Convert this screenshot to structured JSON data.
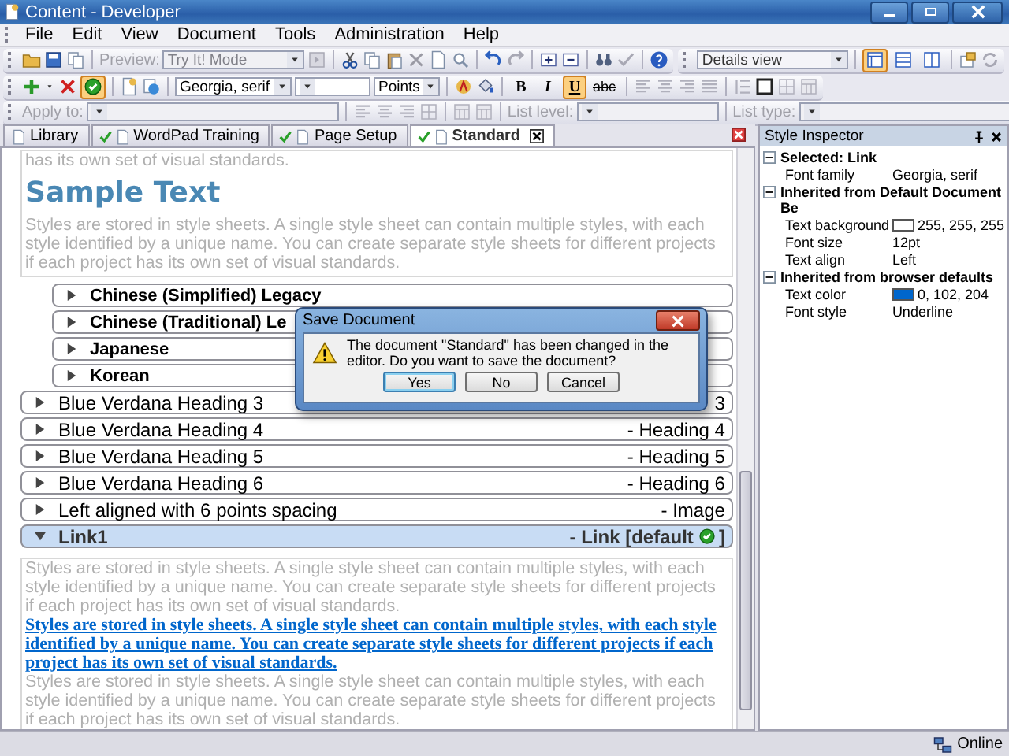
{
  "window": {
    "title": "Content - Developer"
  },
  "menu": [
    "File",
    "Edit",
    "View",
    "Document",
    "Tools",
    "Administration",
    "Help"
  ],
  "toolbar": {
    "preview_label": {
      "text": "Preview:",
      "disabled": true
    },
    "mode_select": {
      "value": "Try It! Mode",
      "disabled": true
    },
    "view_select": {
      "value": "Details view"
    },
    "layout_buttons": [
      {
        "selected": true
      },
      {
        "selected": false
      },
      {
        "selected": false
      }
    ],
    "validate_button": {
      "on": true
    },
    "font_select": {
      "value": "Georgia, serif"
    },
    "units_select": {
      "value": "Points"
    },
    "format_buttons": [
      {
        "kind": "bold",
        "label": "B",
        "on": false
      },
      {
        "kind": "italic",
        "label": "I",
        "on": false
      },
      {
        "kind": "underline",
        "label": "U",
        "on": true
      },
      {
        "kind": "strike",
        "label": "abc",
        "on": false
      }
    ],
    "apply_label": {
      "text": "Apply to:",
      "disabled": true
    },
    "list_level_label": {
      "text": "List level:",
      "disabled": true
    },
    "list_type_label": {
      "text": "List type:",
      "disabled": true
    }
  },
  "tabs": [
    {
      "label": "Library",
      "selected": false,
      "checked": false
    },
    {
      "label": "WordPad Training",
      "selected": false,
      "checked": true
    },
    {
      "label": "Page Setup",
      "selected": false,
      "checked": true
    },
    {
      "label": "Standard",
      "selected": true,
      "checked": true
    }
  ],
  "editor": {
    "top_text": "has its own set of visual standards.",
    "heading": "Sample Text",
    "paragraph": "Styles are stored in style sheets. A single style sheet can contain multiple styles, with each style identified by a unique name. You can create separate style sheets for different projects if each project has its own set of visual standards.",
    "styles": [
      {
        "name": "Chinese (Simplified) Legacy",
        "kind": "group",
        "expanded": false,
        "selected": false,
        "default_mark": false
      },
      {
        "name": "Chinese (Traditional) Le",
        "kind": "group",
        "expanded": false,
        "selected": false,
        "default_mark": false
      },
      {
        "name": "Japanese",
        "kind": "group",
        "expanded": false,
        "selected": false,
        "default_mark": false
      },
      {
        "name": "Korean",
        "kind": "group",
        "expanded": false,
        "selected": false,
        "default_mark": false
      },
      {
        "name": "Blue Verdana Heading 3",
        "kind": "style",
        "type_label": "3",
        "expanded": false,
        "selected": false,
        "default_mark": false
      },
      {
        "name": "Blue Verdana Heading 4",
        "kind": "style",
        "type_label": "- Heading 4",
        "expanded": false,
        "selected": false,
        "default_mark": false
      },
      {
        "name": "Blue Verdana Heading 5",
        "kind": "style",
        "type_label": "- Heading 5",
        "expanded": false,
        "selected": false,
        "default_mark": false
      },
      {
        "name": "Blue Verdana Heading 6",
        "kind": "style",
        "type_label": "- Heading 6",
        "expanded": false,
        "selected": false,
        "default_mark": false
      },
      {
        "name": "Left aligned with 6 points spacing",
        "kind": "style",
        "type_label": "- Image",
        "expanded": false,
        "selected": false,
        "default_mark": false
      },
      {
        "name": "Link1",
        "kind": "style",
        "type_label": "- Link [default",
        "type_label_end": "]",
        "expanded": true,
        "selected": true,
        "default_mark": true
      }
    ],
    "link_paragraph": {
      "before": "Styles are stored in style sheets. A single style sheet can contain multiple styles, with each style identified by a unique name. You can create separate style sheets for different projects if each project has its own set of visual standards.",
      "link": "Styles are stored in style sheets. A single style sheet can contain multiple styles, with each style identified by a unique name. You can create separate style sheets for different projects if each project has its own set of visual standards.",
      "after": "Styles are stored in style sheets. A single style sheet can contain multiple styles, with each style identified by a unique name. You can create separate style sheets for different projects if each project has its own set of visual standards."
    }
  },
  "dialog": {
    "title": "Save Document",
    "message": "The document \"Standard\" has been changed in the editor. Do you want to save the document?",
    "buttons": [
      {
        "label": "Yes",
        "selected": true
      },
      {
        "label": "No",
        "selected": false
      },
      {
        "label": "Cancel",
        "selected": false
      }
    ]
  },
  "inspector": {
    "title": "Style Inspector",
    "sections": [
      {
        "title": "Selected: Link",
        "expanded": true,
        "properties": [
          {
            "name": "Font family",
            "value": "Georgia, serif"
          }
        ]
      },
      {
        "title": "Inherited from Default Document Be",
        "expanded": true,
        "properties": [
          {
            "name": "Text background",
            "value": "255, 255, 255",
            "color": "#ffffff"
          },
          {
            "name": "Font size",
            "value": "12pt"
          },
          {
            "name": "Text align",
            "value": "Left"
          }
        ]
      },
      {
        "title": "Inherited from browser defaults",
        "expanded": true,
        "properties": [
          {
            "name": "Text color",
            "value": "0, 102, 204",
            "color": "#0066cc"
          },
          {
            "name": "Font style",
            "value": "Underline"
          }
        ]
      }
    ]
  },
  "status_bar": {
    "status": "Online"
  }
}
